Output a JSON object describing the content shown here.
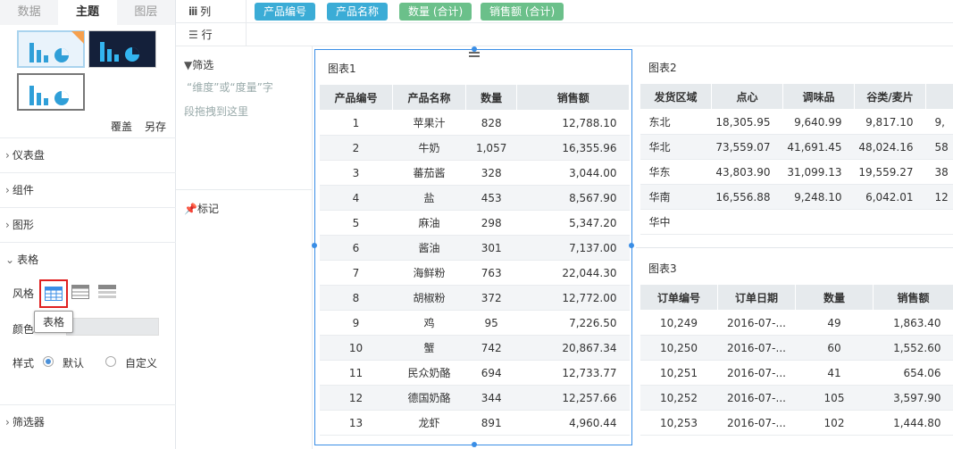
{
  "left_tabs": [
    "数据",
    "主题",
    "图层"
  ],
  "theme_actions": {
    "cover": "覆盖",
    "save_as": "另存"
  },
  "sections": [
    "仪表盘",
    "组件",
    "图形",
    "表格",
    "筛选器"
  ],
  "style_row": {
    "label": "风格",
    "tooltip": "表格"
  },
  "color_row": {
    "label": "颜色"
  },
  "mode_row": {
    "label": "样式",
    "default": "默认",
    "custom": "自定义"
  },
  "topbar": {
    "columns_label": "列",
    "rows_label": "行",
    "pills": [
      {
        "text": "产品编号",
        "color": "#3bacd6"
      },
      {
        "text": "产品名称",
        "color": "#3bacd6"
      },
      {
        "text": "数量 (合计)",
        "color": "#6bc08a"
      },
      {
        "text": "销售额 (合计)",
        "color": "#6bc08a"
      }
    ]
  },
  "filters": {
    "filter_title": "筛选",
    "hint_line1": "“维度”或“度量”字",
    "hint_line2": "段拖拽到这里",
    "mark_title": "标记"
  },
  "chart1": {
    "title": "图表1",
    "headers": [
      "产品编号",
      "产品名称",
      "数量",
      "销售额"
    ],
    "rows": [
      [
        "1",
        "苹果汁",
        "828",
        "12,788.10"
      ],
      [
        "2",
        "牛奶",
        "1,057",
        "16,355.96"
      ],
      [
        "3",
        "蕃茄酱",
        "328",
        "3,044.00"
      ],
      [
        "4",
        "盐",
        "453",
        "8,567.90"
      ],
      [
        "5",
        "麻油",
        "298",
        "5,347.20"
      ],
      [
        "6",
        "酱油",
        "301",
        "7,137.00"
      ],
      [
        "7",
        "海鲜粉",
        "763",
        "22,044.30"
      ],
      [
        "8",
        "胡椒粉",
        "372",
        "12,772.00"
      ],
      [
        "9",
        "鸡",
        "95",
        "7,226.50"
      ],
      [
        "10",
        "蟹",
        "742",
        "20,867.34"
      ],
      [
        "11",
        "民众奶酪",
        "694",
        "12,733.77"
      ],
      [
        "12",
        "德国奶酪",
        "344",
        "12,257.66"
      ],
      [
        "13",
        "龙虾",
        "891",
        "4,960.44"
      ]
    ]
  },
  "chart2": {
    "title": "图表2",
    "headers": [
      "发货区域",
      "点心",
      "调味品",
      "谷类/麦片",
      ""
    ],
    "rows": [
      [
        "东北",
        "18,305.95",
        "9,640.99",
        "9,817.10",
        "9,"
      ],
      [
        "华北",
        "73,559.07",
        "41,691.45",
        "48,024.16",
        "58"
      ],
      [
        "华东",
        "43,803.90",
        "31,099.13",
        "19,559.27",
        "38"
      ],
      [
        "华南",
        "16,556.88",
        "9,248.10",
        "6,042.01",
        "12"
      ],
      [
        "华中",
        "",
        "",
        "",
        ""
      ]
    ]
  },
  "chart3": {
    "title": "图表3",
    "headers": [
      "订单编号",
      "订单日期",
      "数量",
      "销售额"
    ],
    "rows": [
      [
        "10,249",
        "2016-07-...",
        "49",
        "1,863.40"
      ],
      [
        "10,250",
        "2016-07-...",
        "60",
        "1,552.60"
      ],
      [
        "10,251",
        "2016-07-...",
        "41",
        "654.06"
      ],
      [
        "10,252",
        "2016-07-...",
        "105",
        "3,597.90"
      ],
      [
        "10,253",
        "2016-07-...",
        "102",
        "1,444.80"
      ]
    ]
  }
}
